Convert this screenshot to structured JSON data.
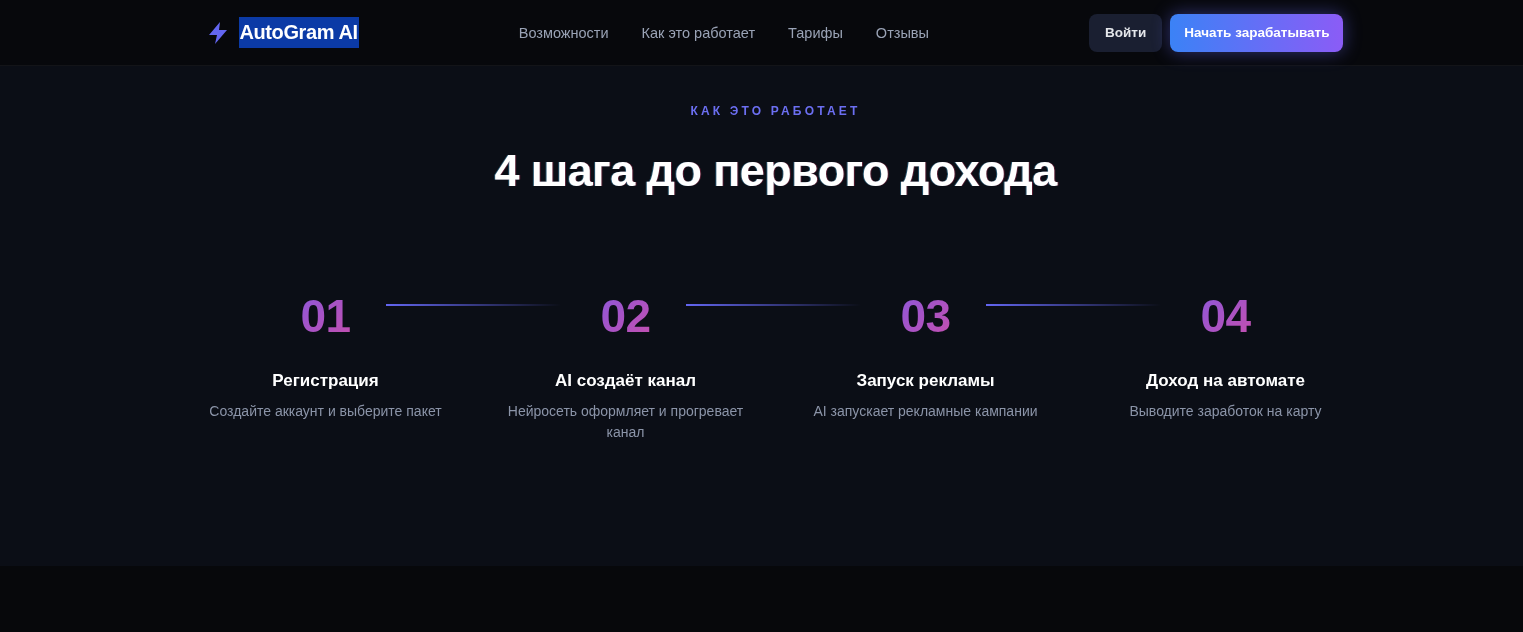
{
  "header": {
    "logo": {
      "text": "AutoGram AI",
      "highlighted": true
    },
    "nav": [
      "Возможности",
      "Как это работает",
      "Тарифы",
      "Отзывы"
    ],
    "buttons": [
      {
        "label": "Войти",
        "kind": "secondary"
      },
      {
        "label": "Начать зарабатывать",
        "kind": "primary"
      }
    ]
  },
  "section": {
    "eyebrow": "КАК ЭТО РАБОТАЕТ",
    "title": "4 шага до первого дохода",
    "steps": [
      {
        "number": "01",
        "title": "Регистрация",
        "description": "Создайте аккаунт и выберите пакет",
        "connector": true
      },
      {
        "number": "02",
        "title": "AI создаёт канал",
        "description": "Нейросеть оформляет и прогревает канал",
        "connector": true
      },
      {
        "number": "03",
        "title": "Запуск рекламы",
        "description": "AI запускает рекламные кампании",
        "connector": true
      },
      {
        "number": "04",
        "title": "Доход на автомате",
        "description": "Выводите заработок на карту",
        "connector": false
      }
    ]
  }
}
